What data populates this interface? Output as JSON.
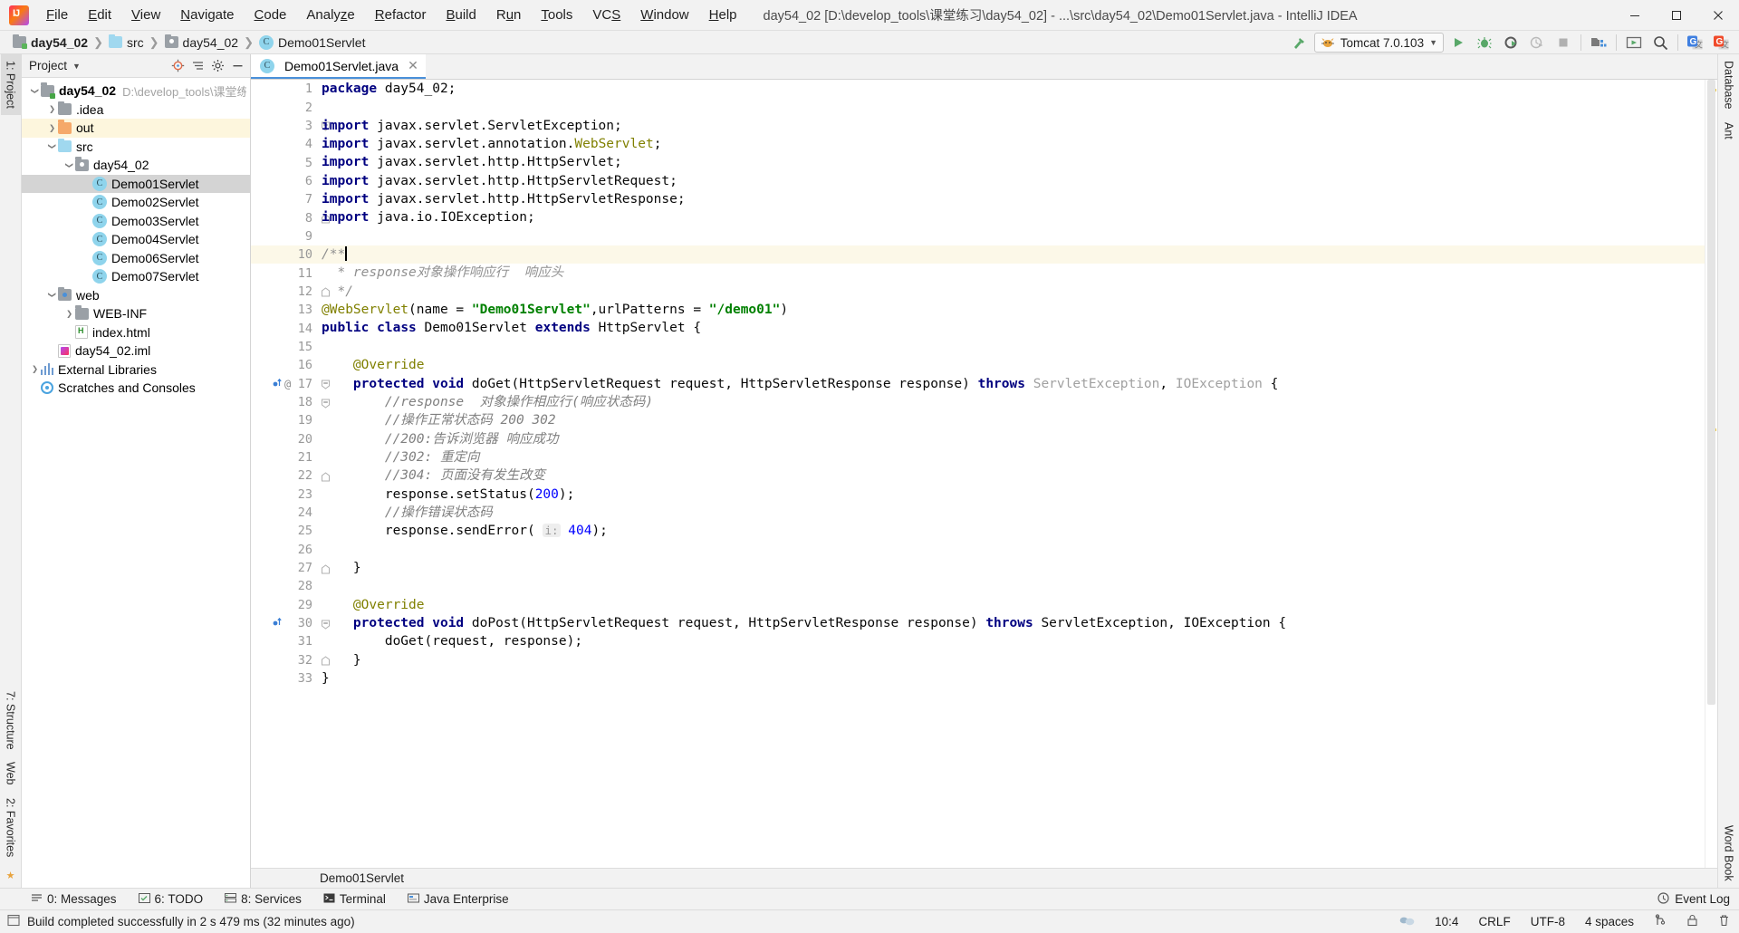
{
  "window": {
    "title": "day54_02 [D:\\develop_tools\\课堂练习\\day54_02] - ...\\src\\day54_02\\Demo01Servlet.java - IntelliJ IDEA",
    "logo_text": "IJ",
    "minimize": "minimize-icon",
    "maximize": "maximize-icon",
    "close": "close-icon"
  },
  "menu": [
    {
      "label": "File"
    },
    {
      "label": "Edit"
    },
    {
      "label": "View"
    },
    {
      "label": "Navigate"
    },
    {
      "label": "Code"
    },
    {
      "label": "Analyze"
    },
    {
      "label": "Refactor"
    },
    {
      "label": "Build"
    },
    {
      "label": "Run"
    },
    {
      "label": "Tools"
    },
    {
      "label": "VCS"
    },
    {
      "label": "Window"
    },
    {
      "label": "Help"
    }
  ],
  "breadcrumbs": [
    {
      "label": "day54_02",
      "icon": "module-folder-icon"
    },
    {
      "label": "src",
      "icon": "source-folder-icon"
    },
    {
      "label": "day54_02",
      "icon": "package-folder-icon"
    },
    {
      "label": "Demo01Servlet",
      "icon": "java-class-icon"
    }
  ],
  "toolbar": {
    "build_icon": "hammer-icon",
    "run_config": {
      "label": "Tomcat 7.0.103",
      "icon": "tomcat-icon",
      "chevron": "chevron-down-icon"
    },
    "actions": [
      {
        "name": "run-button",
        "icon": "run-play-icon"
      },
      {
        "name": "debug-button",
        "icon": "debug-bug-icon"
      },
      {
        "name": "run-with-coverage-button",
        "icon": "coverage-icon"
      },
      {
        "name": "profiler-button",
        "icon": "profiler-clock-icon"
      },
      {
        "name": "stop-button",
        "icon": "stop-square-icon"
      },
      {
        "name": "project-structure-button",
        "icon": "project-structure-icon"
      },
      {
        "name": "update-app-button",
        "icon": "update-app-icon"
      },
      {
        "name": "search-everywhere-button",
        "icon": "search-icon"
      },
      {
        "name": "google-translate-button",
        "icon": "google-translate-blue-icon"
      },
      {
        "name": "translate-button",
        "icon": "translate-red-icon"
      }
    ]
  },
  "project_pane": {
    "title": "Project",
    "caret": "chevron-down-icon",
    "actions": [
      {
        "name": "locate-button",
        "icon": "target-icon"
      },
      {
        "name": "collapse-all-button",
        "icon": "collapse-all-icon"
      },
      {
        "name": "settings-button",
        "icon": "gear-icon"
      },
      {
        "name": "hide-button",
        "icon": "minus-icon"
      }
    ],
    "tree": [
      {
        "label": "day54_02",
        "path": "D:\\develop_tools\\课堂练习",
        "icon": "module-folder-icon",
        "indent": 0,
        "arrow": "expanded",
        "bold": true,
        "state": "normal"
      },
      {
        "label": ".idea",
        "path": "",
        "icon": "folder-icon",
        "indent": 1,
        "arrow": "collapsed",
        "bold": false,
        "state": "normal"
      },
      {
        "label": "out",
        "path": "",
        "icon": "output-folder-icon",
        "indent": 1,
        "arrow": "collapsed",
        "bold": false,
        "state": "highlight"
      },
      {
        "label": "src",
        "path": "",
        "icon": "source-folder-icon",
        "indent": 1,
        "arrow": "expanded",
        "bold": false,
        "state": "normal"
      },
      {
        "label": "day54_02",
        "path": "",
        "icon": "package-folder-icon",
        "indent": 2,
        "arrow": "expanded",
        "bold": false,
        "state": "normal"
      },
      {
        "label": "Demo01Servlet",
        "path": "",
        "icon": "java-class-icon",
        "indent": 3,
        "arrow": "none",
        "bold": false,
        "state": "selected"
      },
      {
        "label": "Demo02Servlet",
        "path": "",
        "icon": "java-class-icon",
        "indent": 3,
        "arrow": "none",
        "bold": false,
        "state": "normal"
      },
      {
        "label": "Demo03Servlet",
        "path": "",
        "icon": "java-class-icon",
        "indent": 3,
        "arrow": "none",
        "bold": false,
        "state": "normal"
      },
      {
        "label": "Demo04Servlet",
        "path": "",
        "icon": "java-class-icon",
        "indent": 3,
        "arrow": "none",
        "bold": false,
        "state": "normal"
      },
      {
        "label": "Demo06Servlet",
        "path": "",
        "icon": "java-class-icon",
        "indent": 3,
        "arrow": "none",
        "bold": false,
        "state": "normal"
      },
      {
        "label": "Demo07Servlet",
        "path": "",
        "icon": "java-class-icon",
        "indent": 3,
        "arrow": "none",
        "bold": false,
        "state": "normal"
      },
      {
        "label": "web",
        "path": "",
        "icon": "web-folder-icon",
        "indent": 1,
        "arrow": "expanded",
        "bold": false,
        "state": "normal"
      },
      {
        "label": "WEB-INF",
        "path": "",
        "icon": "folder-icon",
        "indent": 2,
        "arrow": "collapsed",
        "bold": false,
        "state": "normal"
      },
      {
        "label": "index.html",
        "path": "",
        "icon": "html-file-icon",
        "indent": 2,
        "arrow": "none",
        "bold": false,
        "state": "normal"
      },
      {
        "label": "day54_02.iml",
        "path": "",
        "icon": "iml-file-icon",
        "indent": 1,
        "arrow": "none",
        "bold": false,
        "state": "normal"
      },
      {
        "label": "External Libraries",
        "path": "",
        "icon": "libraries-icon",
        "indent": 0,
        "arrow": "collapsed",
        "bold": false,
        "state": "normal"
      },
      {
        "label": "Scratches and Consoles",
        "path": "",
        "icon": "scratches-icon",
        "indent": 0,
        "arrow": "none",
        "bold": false,
        "state": "normal"
      }
    ]
  },
  "left_rail": {
    "top": [
      {
        "label": "1: Project",
        "active": true
      }
    ],
    "bottom": [
      {
        "label": "7: Structure",
        "active": false
      },
      {
        "label": "Web",
        "active": false
      },
      {
        "label": "2: Favorites",
        "active": false
      }
    ],
    "star_icon": "star-icon"
  },
  "right_rail": {
    "top": [
      {
        "label": "Database",
        "active": false
      },
      {
        "label": "Ant",
        "active": false
      }
    ],
    "bottom": [
      {
        "label": "Word Book",
        "active": false
      }
    ]
  },
  "editor": {
    "tabs": [
      {
        "label": "Demo01Servlet.java",
        "icon": "java-class-icon",
        "close": "close-icon",
        "active": true
      }
    ],
    "breadcrumb": "Demo01Servlet",
    "current_line": 10,
    "lines": [
      {
        "n": 1,
        "html": "<span class=\"kw\">package</span> day54_02;"
      },
      {
        "n": 2,
        "html": ""
      },
      {
        "n": 3,
        "html": "<span class=\"kw\">import</span> javax.servlet.ServletException;",
        "fold": "start"
      },
      {
        "n": 4,
        "html": "<span class=\"kw\">import</span> javax.servlet.annotation.<span class=\"anno\">WebServlet</span>;"
      },
      {
        "n": 5,
        "html": "<span class=\"kw\">import</span> javax.servlet.http.HttpServlet;"
      },
      {
        "n": 6,
        "html": "<span class=\"kw\">import</span> javax.servlet.http.HttpServletRequest;"
      },
      {
        "n": 7,
        "html": "<span class=\"kw\">import</span> javax.servlet.http.HttpServletResponse;"
      },
      {
        "n": 8,
        "html": "<span class=\"kw\">import</span> java.io.IOException;",
        "fold": "end"
      },
      {
        "n": 9,
        "html": ""
      },
      {
        "n": 10,
        "html": "<span class=\"jdoc\">/**</span><span class=\"caret\"></span>",
        "fold": "start",
        "current": true
      },
      {
        "n": 11,
        "html": "  <span class=\"jdoc\">* response对象操作响应行  响应头</span>"
      },
      {
        "n": 12,
        "html": "  <span class=\"jdoc\">*/</span>",
        "fold": "end"
      },
      {
        "n": 13,
        "html": "<span class=\"anno\">@WebServlet</span>(name = <span class=\"str\">\"Demo01Servlet\"</span>,urlPatterns = <span class=\"str\">\"/demo01\"</span>)"
      },
      {
        "n": 14,
        "html": "<span class=\"kw\">public</span> <span class=\"kw\">class</span> Demo01Servlet <span class=\"kw\">extends</span> HttpServlet {"
      },
      {
        "n": 15,
        "html": ""
      },
      {
        "n": 16,
        "html": "    <span class=\"anno\">@Override</span>"
      },
      {
        "n": 17,
        "html": "    <span class=\"kw\">protected</span> <span class=\"kw\">void</span> doGet(HttpServletRequest request, HttpServletResponse response) <span class=\"kw\">throws</span> <span class=\"cls-fade\">ServletException</span>, <span class=\"cls-fade\">IOException</span> {",
        "gutter_marks": [
          "override-method-icon",
          "annotation-icon"
        ],
        "fold": "start"
      },
      {
        "n": 18,
        "html": "        <span class=\"cmt\">//response  对象操作相应行(响应状态码)</span>",
        "fold": "start"
      },
      {
        "n": 19,
        "html": "        <span class=\"cmt\">//操作正常状态码 200 302</span>"
      },
      {
        "n": 20,
        "html": "        <span class=\"cmt\">//200:告诉浏览器 响应成功</span>"
      },
      {
        "n": 21,
        "html": "        <span class=\"cmt\">//302: 重定向</span>"
      },
      {
        "n": 22,
        "html": "        <span class=\"cmt\">//304: 页面没有发生改变</span>",
        "fold": "end"
      },
      {
        "n": 23,
        "html": "        response.setStatus(<span class=\"num\">200</span>);"
      },
      {
        "n": 24,
        "html": "        <span class=\"cmt\">//操作错误状态码</span>"
      },
      {
        "n": 25,
        "html": "        response.sendError( <span class=\"hintbg\">i:</span> <span class=\"num\">404</span>);"
      },
      {
        "n": 26,
        "html": ""
      },
      {
        "n": 27,
        "html": "    }",
        "fold": "end"
      },
      {
        "n": 28,
        "html": ""
      },
      {
        "n": 29,
        "html": "    <span class=\"anno\">@Override</span>"
      },
      {
        "n": 30,
        "html": "    <span class=\"kw\">protected</span> <span class=\"kw\">void</span> doPost(HttpServletRequest request, HttpServletResponse response) <span class=\"kw\">throws</span> ServletException, IOException {",
        "gutter_marks": [
          "override-method-icon"
        ],
        "fold": "start"
      },
      {
        "n": 31,
        "html": "        doGet(request, response);"
      },
      {
        "n": 32,
        "html": "    }",
        "fold": "end"
      },
      {
        "n": 33,
        "html": "}"
      }
    ]
  },
  "bottom_tools": [
    {
      "label": "0: Messages",
      "icon": "messages-icon"
    },
    {
      "label": "6: TODO",
      "icon": "todo-icon"
    },
    {
      "label": "8: Services",
      "icon": "services-icon"
    },
    {
      "label": "Terminal",
      "icon": "terminal-icon"
    },
    {
      "label": "Java Enterprise",
      "icon": "java-enterprise-icon"
    }
  ],
  "event_log": {
    "label": "Event Log",
    "icon": "event-log-icon"
  },
  "statusbar": {
    "message": "Build completed successfully in 2 s 479 ms (32 minutes ago)",
    "caret_position": "10:4",
    "line_separator": "CRLF",
    "encoding": "UTF-8",
    "indent": "4 spaces",
    "time": "",
    "items": [
      {
        "name": "notification-icon",
        "label": ""
      },
      {
        "name": "git-branch-icon",
        "label": ""
      },
      {
        "name": "lock-icon",
        "label": ""
      },
      {
        "name": "trash-icon",
        "label": ""
      }
    ]
  },
  "colors": {
    "accent_blue": "#4a90d9",
    "chrome": "#f2f2f2",
    "editor_bg": "#ffffff",
    "current_line": "#fcf8e8",
    "selection": "#d4d4d4",
    "keyword": "#000080",
    "string": "#008000",
    "comment": "#808080",
    "annotation": "#808000",
    "number": "#0000ff",
    "tomcat_orange": "#e8a33d",
    "run_green": "#59a869"
  }
}
